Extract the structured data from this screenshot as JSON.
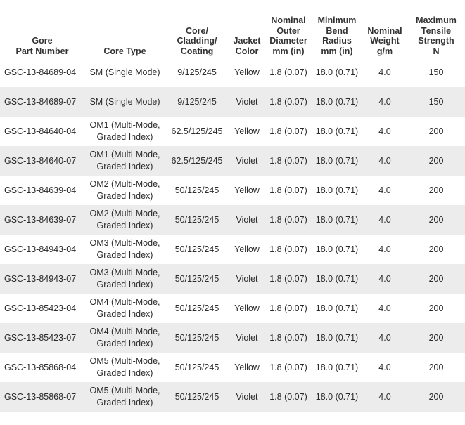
{
  "table": {
    "headers": [
      [
        "Gore",
        "Part Number"
      ],
      [
        "Core Type"
      ],
      [
        "Core/",
        "Cladding/",
        "Coating"
      ],
      [
        "Jacket",
        "Color"
      ],
      [
        "Nominal",
        "Outer",
        "Diameter",
        "mm (in)"
      ],
      [
        "Minimum",
        "Bend",
        "Radius",
        "mm (in)"
      ],
      [
        "Nominal",
        "Weight",
        "g/m"
      ],
      [
        "Maximum",
        "Tensile",
        "Strength",
        "N"
      ]
    ],
    "rows": [
      {
        "part": "GSC-13-84689-04",
        "core_type": [
          "SM (Single Mode)"
        ],
        "ccc": "9/125/245",
        "color": "Yellow",
        "diameter": "1.8 (0.07)",
        "radius": "18.0 (0.71)",
        "weight": "4.0",
        "tensile": "150"
      },
      {
        "part": "GSC-13-84689-07",
        "core_type": [
          "SM (Single Mode)"
        ],
        "ccc": "9/125/245",
        "color": "Violet",
        "diameter": "1.8 (0.07)",
        "radius": "18.0 (0.71)",
        "weight": "4.0",
        "tensile": "150"
      },
      {
        "part": "GSC-13-84640-04",
        "core_type": [
          "OM1 (Multi-Mode,",
          "Graded Index)"
        ],
        "ccc": "62.5/125/245",
        "color": "Yellow",
        "diameter": "1.8 (0.07)",
        "radius": "18.0 (0.71)",
        "weight": "4.0",
        "tensile": "200"
      },
      {
        "part": "GSC-13-84640-07",
        "core_type": [
          "OM1 (Multi-Mode,",
          "Graded Index)"
        ],
        "ccc": "62.5/125/245",
        "color": "Violet",
        "diameter": "1.8 (0.07)",
        "radius": "18.0 (0.71)",
        "weight": "4.0",
        "tensile": "200"
      },
      {
        "part": "GSC-13-84639-04",
        "core_type": [
          "OM2 (Multi-Mode,",
          "Graded Index)"
        ],
        "ccc": "50/125/245",
        "color": "Yellow",
        "diameter": "1.8 (0.07)",
        "radius": "18.0 (0.71)",
        "weight": "4.0",
        "tensile": "200"
      },
      {
        "part": "GSC-13-84639-07",
        "core_type": [
          "OM2 (Multi-Mode,",
          "Graded Index)"
        ],
        "ccc": "50/125/245",
        "color": "Violet",
        "diameter": "1.8 (0.07)",
        "radius": "18.0 (0.71)",
        "weight": "4.0",
        "tensile": "200"
      },
      {
        "part": "GSC-13-84943-04",
        "core_type": [
          "OM3 (Multi-Mode,",
          "Graded Index)"
        ],
        "ccc": "50/125/245",
        "color": "Yellow",
        "diameter": "1.8 (0.07)",
        "radius": "18.0 (0.71)",
        "weight": "4.0",
        "tensile": "200"
      },
      {
        "part": "GSC-13-84943-07",
        "core_type": [
          "OM3 (Multi-Mode,",
          "Graded Index)"
        ],
        "ccc": "50/125/245",
        "color": "Violet",
        "diameter": "1.8 (0.07)",
        "radius": "18.0 (0.71)",
        "weight": "4.0",
        "tensile": "200"
      },
      {
        "part": "GSC-13-85423-04",
        "core_type": [
          "OM4 (Multi-Mode,",
          "Graded Index)"
        ],
        "ccc": "50/125/245",
        "color": "Yellow",
        "diameter": "1.8 (0.07)",
        "radius": "18.0 (0.71)",
        "weight": "4.0",
        "tensile": "200"
      },
      {
        "part": "GSC-13-85423-07",
        "core_type": [
          "OM4 (Multi-Mode,",
          "Graded Index)"
        ],
        "ccc": "50/125/245",
        "color": "Violet",
        "diameter": "1.8 (0.07)",
        "radius": "18.0 (0.71)",
        "weight": "4.0",
        "tensile": "200"
      },
      {
        "part": "GSC-13-85868-04",
        "core_type": [
          "OM5 (Multi-Mode,",
          "Graded Index)"
        ],
        "ccc": "50/125/245",
        "color": "Yellow",
        "diameter": "1.8 (0.07)",
        "radius": "18.0 (0.71)",
        "weight": "4.0",
        "tensile": "200"
      },
      {
        "part": "GSC-13-85868-07",
        "core_type": [
          "OM5 (Multi-Mode,",
          "Graded Index)"
        ],
        "ccc": "50/125/245",
        "color": "Violet",
        "diameter": "1.8 (0.07)",
        "radius": "18.0 (0.71)",
        "weight": "4.0",
        "tensile": "200"
      }
    ]
  },
  "colors": {
    "stripe": "#ececec",
    "text": "#2b2b2b"
  }
}
